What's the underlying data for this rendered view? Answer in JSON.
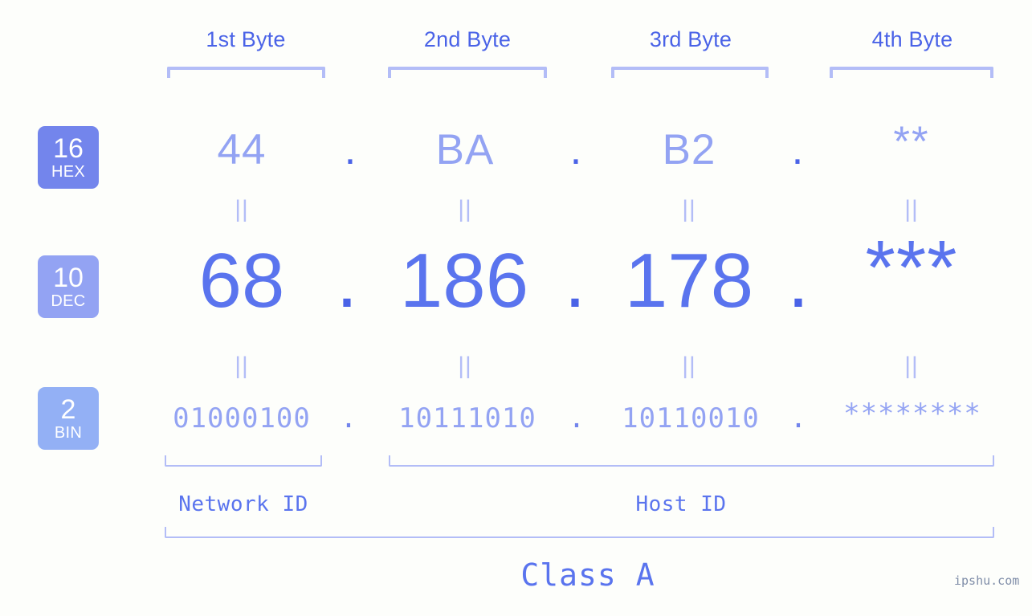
{
  "page": {
    "background_color": "#fdfefb",
    "watermark": "ipshu.com"
  },
  "colors": {
    "accent_strong": "#4a63e7",
    "accent_medium": "#5a74ee",
    "accent_light": "#93a3f3",
    "accent_pale": "#b3bdf7",
    "badge_hex_bg": "#7385ec",
    "badge_dec_bg": "#93a3f3",
    "badge_bin_bg": "#93b0f5",
    "watermark_color": "#7f8da8"
  },
  "byte_headers": [
    {
      "label": "1st Byte"
    },
    {
      "label": "2nd Byte"
    },
    {
      "label": "3rd Byte"
    },
    {
      "label": "4th Byte"
    }
  ],
  "bases": [
    {
      "number": "16",
      "name": "HEX"
    },
    {
      "number": "10",
      "name": "DEC"
    },
    {
      "number": "2",
      "name": "BIN"
    }
  ],
  "rows": {
    "hex": {
      "base_number": "16",
      "base_name": "HEX",
      "values": [
        "44",
        "BA",
        "B2",
        "**"
      ],
      "separators": [
        ".",
        ".",
        "."
      ]
    },
    "dec": {
      "base_number": "10",
      "base_name": "DEC",
      "values": [
        "68",
        "186",
        "178",
        "***"
      ],
      "separators": [
        ".",
        ".",
        "."
      ]
    },
    "bin": {
      "base_number": "2",
      "base_name": "BIN",
      "values": [
        "01000100",
        "10111010",
        "10110010",
        "********"
      ],
      "separators": [
        ".",
        ".",
        "."
      ]
    }
  },
  "equals_connectors": {
    "symbol": "||",
    "count_per_row": 4,
    "rows": 2
  },
  "segments": {
    "network_id": "Network ID",
    "host_id": "Host ID",
    "ip_class": "Class A"
  }
}
